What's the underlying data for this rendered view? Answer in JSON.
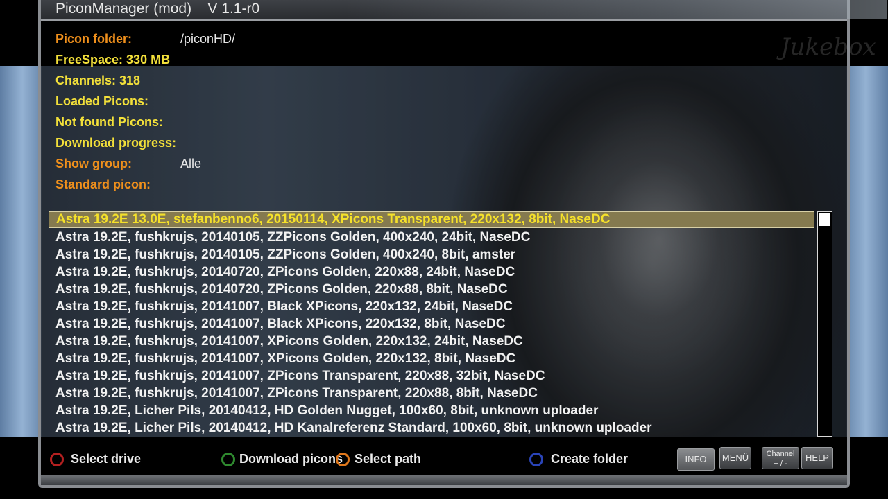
{
  "window": {
    "title": "PiconManager (mod)    V 1.1-r0"
  },
  "watermark": "Jukebox",
  "info": {
    "picon_folder_label": "Picon folder:",
    "picon_folder_value": "/piconHD/",
    "freespace_label": "FreeSpace: 330 MB",
    "channels_label": "Channels: 318",
    "loaded_label": "Loaded Picons:",
    "notfound_label": "Not found Picons:",
    "progress_label": "Download progress:",
    "show_group_label": "Show group:",
    "show_group_value": "Alle",
    "standard_label": "Standard picon:"
  },
  "list": {
    "selected_index": 0,
    "items": [
      "Astra 19.2E 13.0E, stefanbenno6, 20150114, XPicons Transparent, 220x132, 8bit, NaseDC",
      "Astra 19.2E, fushkrujs, 20140105, ZZPicons Golden, 400x240, 24bit, NaseDC",
      "Astra 19.2E, fushkrujs, 20140105, ZZPicons Golden, 400x240, 8bit, amster",
      "Astra 19.2E, fushkrujs, 20140720, ZPicons Golden, 220x88, 24bit, NaseDC",
      "Astra 19.2E, fushkrujs, 20140720, ZPicons Golden, 220x88, 8bit, NaseDC",
      "Astra 19.2E, fushkrujs, 20141007, Black XPicons, 220x132, 24bit, NaseDC",
      "Astra 19.2E, fushkrujs, 20141007, Black XPicons, 220x132, 8bit, NaseDC",
      "Astra 19.2E, fushkrujs, 20141007, XPicons Golden, 220x132, 24bit, NaseDC",
      "Astra 19.2E, fushkrujs, 20141007, XPicons Golden, 220x132, 8bit, NaseDC",
      "Astra 19.2E, fushkrujs, 20141007, ZPicons Transparent, 220x88, 32bit, NaseDC",
      "Astra 19.2E, fushkrujs, 20141007, ZPicons Transparent, 220x88, 8bit, NaseDC",
      "Astra 19.2E, Licher Pils, 20140412, HD Golden Nugget, 100x60, 8bit, unknown uploader",
      "Astra 19.2E, Licher Pils, 20140412, HD Kanalreferenz Standard, 100x60, 8bit, unknown uploader"
    ]
  },
  "buttons": {
    "red": "Select drive",
    "green": "Download picons",
    "orange": "Select path",
    "blue": "Create folder",
    "info": "INFO",
    "menu": "MENÜ",
    "channel_top": "Channel",
    "channel_bottom": "+ / -",
    "help": "HELP"
  },
  "colors": {
    "red": "#b42020",
    "green": "#2f8a2f",
    "orange": "#e0781c",
    "blue": "#2a44b8",
    "accent_orange": "#f0901c",
    "accent_yellow": "#f3e03a"
  }
}
